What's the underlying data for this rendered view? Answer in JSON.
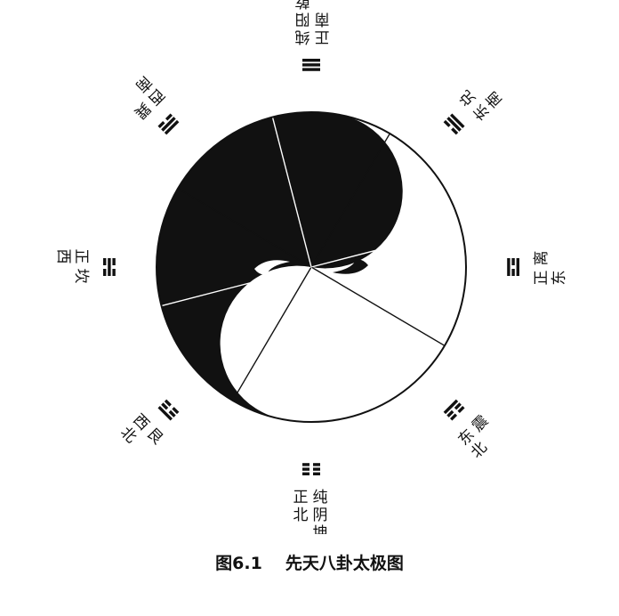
{
  "figure": {
    "caption_number": "图6.1",
    "caption_title": "先天八卦太极图"
  },
  "trigrams": [
    {
      "id": "qian",
      "angle": 0,
      "lines": [
        1,
        1,
        1
      ],
      "label": [
        "纯",
        "阳",
        "乾"
      ],
      "direction": [
        "正",
        "南"
      ]
    },
    {
      "id": "xun",
      "angle": 45,
      "lines": [
        0,
        1,
        1
      ],
      "label": [
        "巽"
      ],
      "direction": [
        "西",
        "南"
      ]
    },
    {
      "id": "kan",
      "angle": 90,
      "lines": [
        0,
        1,
        0
      ],
      "label": [
        "坎"
      ],
      "direction": [
        "正",
        "西"
      ]
    },
    {
      "id": "gen",
      "angle": 135,
      "lines": [
        1,
        0,
        0
      ],
      "label": [
        "艮"
      ],
      "direction": [
        "西",
        "北"
      ]
    },
    {
      "id": "kun",
      "angle": 180,
      "lines": [
        0,
        0,
        0
      ],
      "label": [
        "纯",
        "阴",
        "坤"
      ],
      "direction": [
        "正",
        "北"
      ]
    },
    {
      "id": "zhen",
      "angle": 225,
      "lines": [
        0,
        0,
        1
      ],
      "label": [
        "震"
      ],
      "direction": [
        "东",
        "北"
      ]
    },
    {
      "id": "li",
      "angle": 270,
      "lines": [
        1,
        0,
        1
      ],
      "label": [
        "离"
      ],
      "direction": [
        "正",
        "东"
      ]
    },
    {
      "id": "dui",
      "angle": 315,
      "lines": [
        1,
        1,
        0
      ],
      "label": [
        "兑"
      ],
      "direction": [
        "东",
        "南"
      ]
    }
  ],
  "colors": {
    "ink": "#111111",
    "paper": "#ffffff"
  }
}
